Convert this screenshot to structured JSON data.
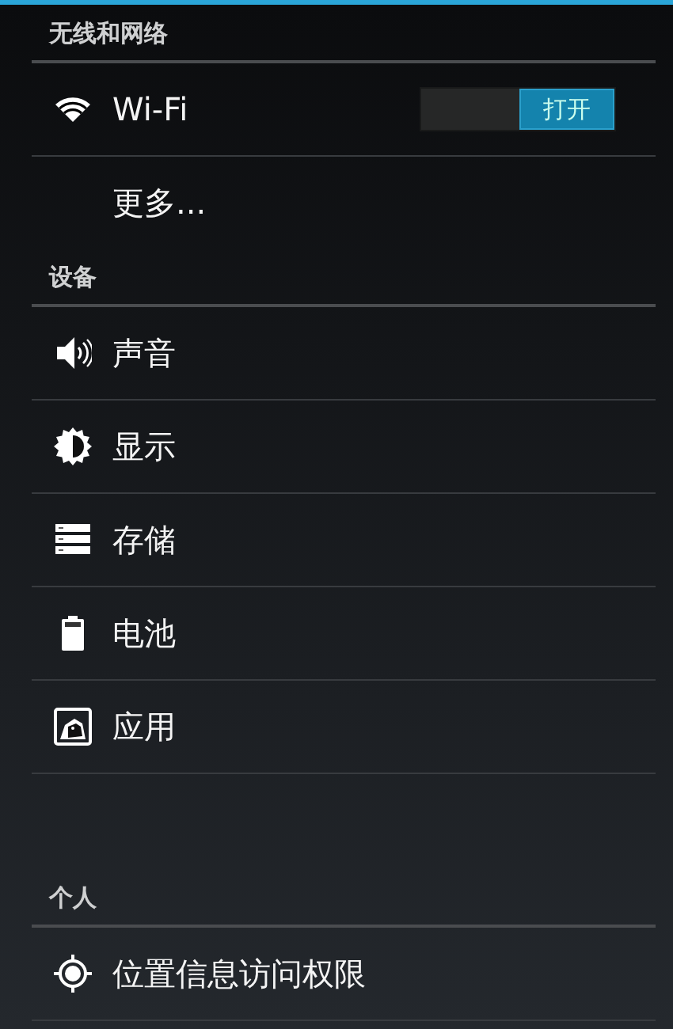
{
  "sections": [
    {
      "header": "无线和网络",
      "items": [
        {
          "kind": "toggle",
          "label": "Wi-Fi",
          "toggle": {
            "on": true,
            "label": "打开"
          }
        },
        {
          "kind": "link",
          "label": "更多..."
        }
      ]
    },
    {
      "header": "设备",
      "items": [
        {
          "kind": "link",
          "label": "声音"
        },
        {
          "kind": "link",
          "label": "显示"
        },
        {
          "kind": "link",
          "label": "存储"
        },
        {
          "kind": "link",
          "label": "电池"
        },
        {
          "kind": "link",
          "label": "应用"
        }
      ]
    },
    {
      "header": "个人",
      "items": [
        {
          "kind": "link",
          "label": "位置信息访问权限"
        }
      ]
    }
  ]
}
